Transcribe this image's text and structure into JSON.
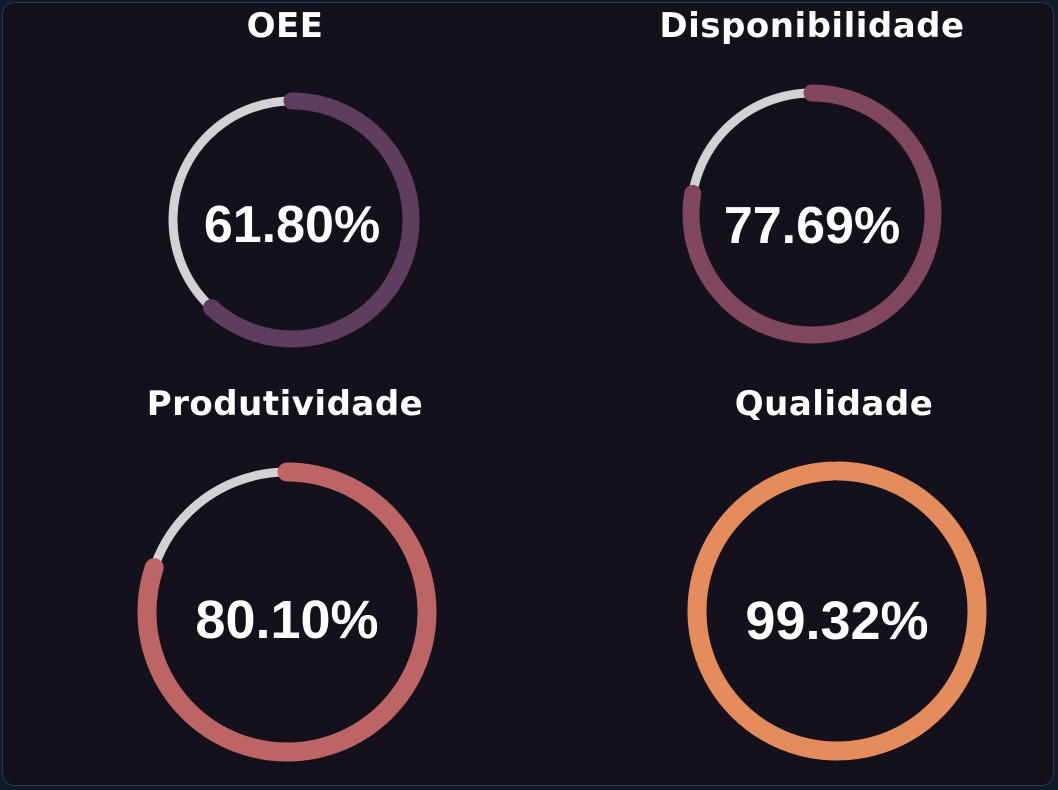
{
  "gauges": [
    {
      "title": "OEE",
      "value": 61.8,
      "value_text": "61.80%",
      "color": "#5e3d5f"
    },
    {
      "title": "Disponibilidade",
      "value": 77.69,
      "value_text": "77.69%",
      "color": "#81475e"
    },
    {
      "title": "Produtividade",
      "value": 80.1,
      "value_text": "80.10%",
      "color": "#bd6565"
    },
    {
      "title": "Qualidade",
      "value": 99.32,
      "value_text": "99.32%",
      "color": "#e58c5d"
    }
  ],
  "track_color": "#d3d1d3"
}
